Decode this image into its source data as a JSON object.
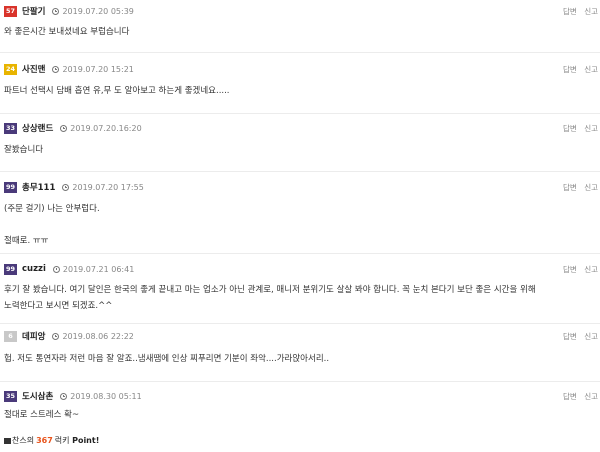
{
  "actions": {
    "reply": "답변",
    "report": "신고"
  },
  "comments": [
    {
      "level": "57",
      "level_color": "#d9342b",
      "nick": "단팔기",
      "date": "2019.07.20 05:39",
      "text": "와 좋은시간 보내셨네요 부럽습니다"
    },
    {
      "level": "24",
      "level_color": "#e8b400",
      "nick": "사진맨",
      "date": "2019.07.20 15:21",
      "text": "파트너 선택시 담배 흡연 유,무 도 알아보고 하는게 좋겠네요....."
    },
    {
      "level": "33",
      "level_color": "#4a3a7a",
      "nick": "상상랜드",
      "date": "2019.07.20.16:20",
      "text": "잘봤습니다"
    },
    {
      "level": "99",
      "level_color": "#4a3a7a",
      "nick": "총무111",
      "date": "2019.07.20 17:55",
      "text": "(주문 걸기) 나는 안부럽다.",
      "text2": "절때로. ㅠㅠ"
    },
    {
      "level": "99",
      "level_color": "#4a3a7a",
      "nick": "cuzzi",
      "date": "2019.07.21 06:41",
      "text": "후기 잘 봤습니다. 여기 달인은 한국의 좋게 끝내고 마는 업소가 아닌 관계로, 매니저 분위기도 살살 봐야 합니다. 꼭 눈치 본다기 보단 좋은 시간을 위해",
      "text2": "노력한다고 보시면 되겠죠.^^"
    },
    {
      "level": "6",
      "level_color": "#c8c8c8",
      "nick": "데피앙",
      "date": "2019.08.06 22:22",
      "text": "헙. 저도 통연자라 저런 마음 잘 알죠..냄새땜에 인상 찌푸리면 기분이 좌악....가라앉아서리.."
    },
    {
      "level": "35",
      "level_color": "#4a3a7a",
      "nick": "도시삼촌",
      "date": "2019.08.30 05:11",
      "text": "절대로 스트레스 확~"
    }
  ],
  "footer": {
    "prefix": "찬스의",
    "number": "367",
    "suffix": "럭키",
    "point": "Point!"
  }
}
